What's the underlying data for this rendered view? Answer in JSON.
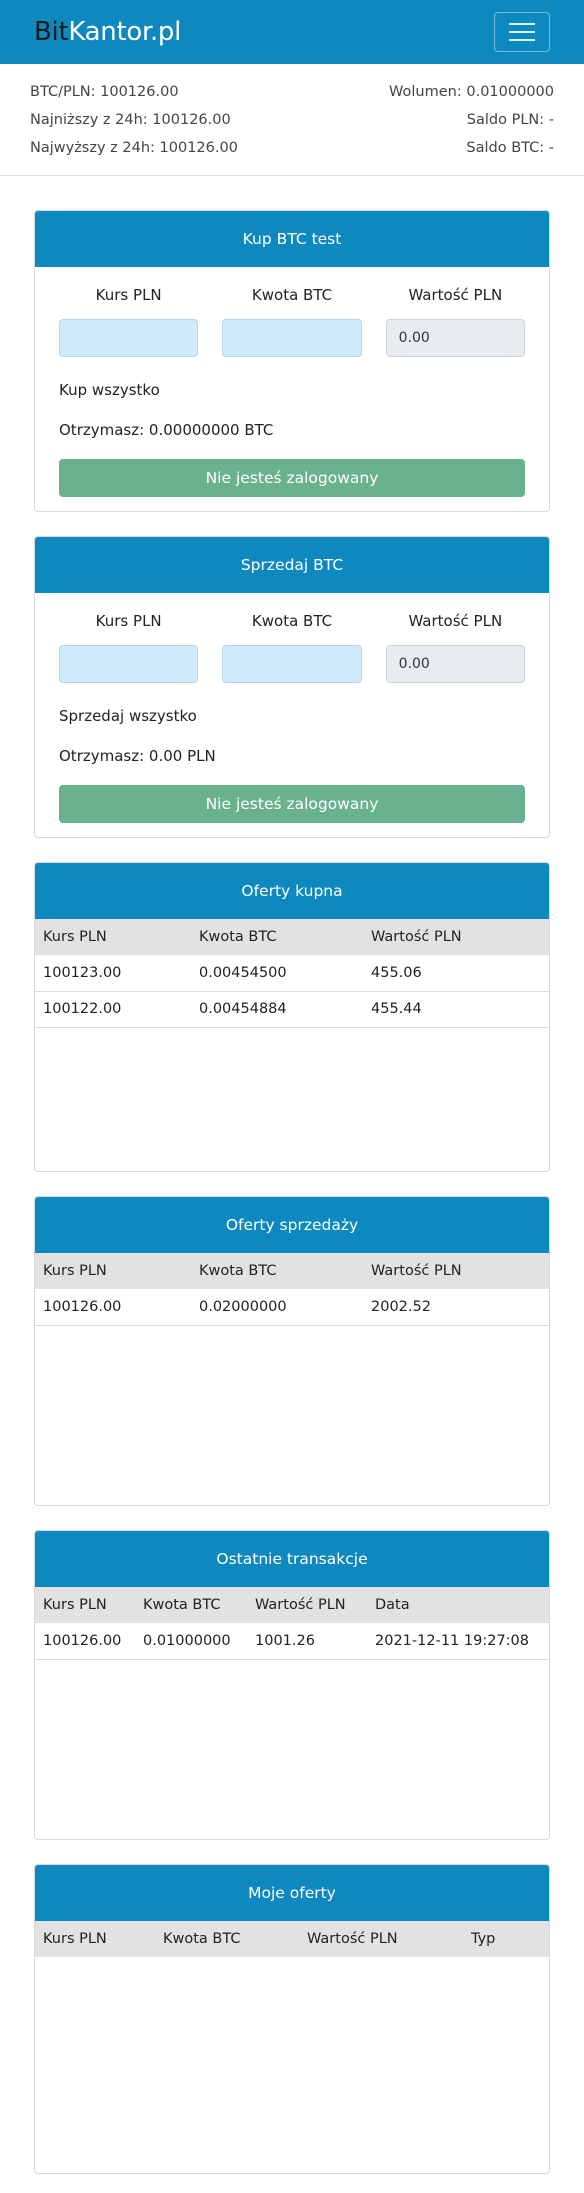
{
  "navbar": {
    "brand_part1": "Bit",
    "brand_part2": "Kantor.pl"
  },
  "stats": {
    "btc_pln_label": "BTC/PLN: 100126.00",
    "low_label": "Najniższy z 24h: 100126.00",
    "high_label": "Najwyższy z 24h: 100126.00",
    "volume_label": "Wolumen: 0.01000000",
    "saldo_pln_label": "Saldo PLN: -",
    "saldo_btc_label": "Saldo BTC: -"
  },
  "buy": {
    "title": "Kup BTC test",
    "rate_label": "Kurs PLN",
    "amount_label": "Kwota BTC",
    "value_label": "Wartość PLN",
    "rate_value": "",
    "amount_value": "",
    "value_value": "0.00",
    "all_link": "Kup wszystko",
    "receive_text": "Otrzymasz: 0.00000000 BTC",
    "button": "Nie jesteś zalogowany"
  },
  "sell": {
    "title": "Sprzedaj BTC",
    "rate_label": "Kurs PLN",
    "amount_label": "Kwota BTC",
    "value_label": "Wartość PLN",
    "rate_value": "",
    "amount_value": "",
    "value_value": "0.00",
    "all_link": "Sprzedaj wszystko",
    "receive_text": "Otrzymasz: 0.00 PLN",
    "button": "Nie jesteś zalogowany"
  },
  "buy_offers": {
    "title": "Oferty kupna",
    "columns": [
      "Kurs PLN",
      "Kwota BTC",
      "Wartość PLN"
    ],
    "rows": [
      [
        "100123.00",
        "0.00454500",
        "455.06"
      ],
      [
        "100122.00",
        "0.00454884",
        "455.44"
      ]
    ]
  },
  "sell_offers": {
    "title": "Oferty sprzedaży",
    "columns": [
      "Kurs PLN",
      "Kwota BTC",
      "Wartość PLN"
    ],
    "rows": [
      [
        "100126.00",
        "0.02000000",
        "2002.52"
      ]
    ]
  },
  "transactions": {
    "title": "Ostatnie transakcje",
    "columns": [
      "Kurs PLN",
      "Kwota BTC",
      "Wartość PLN",
      "Data"
    ],
    "rows": [
      [
        "100126.00",
        "0.01000000",
        "1001.26",
        "2021-12-11 19:27:08"
      ]
    ]
  },
  "my_offers": {
    "title": "Moje oferty",
    "columns": [
      "Kurs PLN",
      "Kwota BTC",
      "Wartość PLN",
      "Typ"
    ],
    "rows": []
  }
}
